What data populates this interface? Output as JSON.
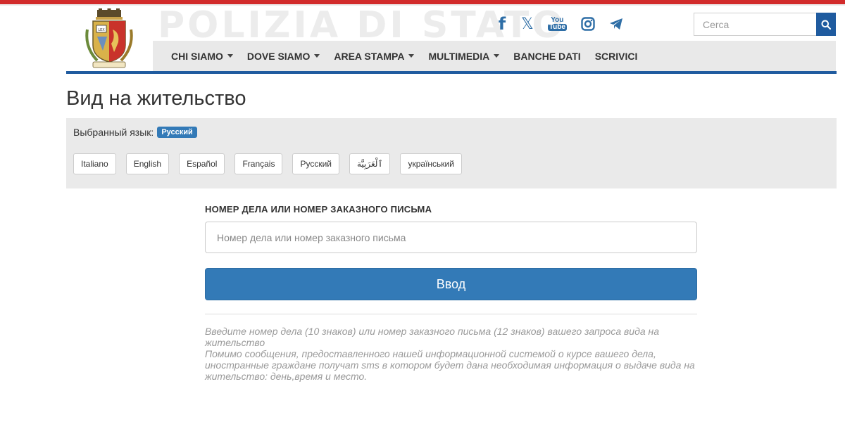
{
  "header": {
    "watermark": "POLIZIA DI STATO",
    "socials": [
      {
        "name": "facebook",
        "glyph": "f"
      },
      {
        "name": "x",
        "glyph": "𝕏"
      },
      {
        "name": "youtube",
        "top": "You",
        "bottom": "Tube"
      },
      {
        "name": "instagram"
      },
      {
        "name": "telegram"
      }
    ],
    "search": {
      "placeholder": "Cerca"
    },
    "nav": [
      {
        "label": "CHI SIAMO",
        "dropdown": true
      },
      {
        "label": "DOVE SIAMO",
        "dropdown": true
      },
      {
        "label": "AREA STAMPA",
        "dropdown": true
      },
      {
        "label": "MULTIMEDIA",
        "dropdown": true
      },
      {
        "label": "BANCHE DATI",
        "dropdown": false
      },
      {
        "label": "SCRIVICI",
        "dropdown": false
      }
    ]
  },
  "page": {
    "title": "Вид на жительство"
  },
  "language": {
    "selected_label": "Выбранный язык:",
    "selected_value": "Русский",
    "options": [
      "Italiano",
      "English",
      "Español",
      "Français",
      "Русский",
      "ٱلْعَرَبِيَّة",
      "український"
    ]
  },
  "form": {
    "label": "НОМЕР ДЕЛА ИЛИ НОМЕР ЗАКАЗНОГО ПИСЬМА",
    "placeholder": "Номер дела или номер заказного письма",
    "submit": "Ввод",
    "help_line1": "Введите номер дела (10 знаков) или номер заказного письма (12 знаков) вашего запроса вида на жительство",
    "help_line2": "Помимо сообщения, предоставленного нашей информационной системой о курсе вашего дела, иностранные граждане получат sms в котором будет дана необходимая информация о выдаче вида на жительство: день,время и место."
  },
  "colors": {
    "brand_blue": "#1f5b9f",
    "button_blue": "#337ab7",
    "top_red": "#d22b2b",
    "panel_gray": "#eaeaea"
  }
}
